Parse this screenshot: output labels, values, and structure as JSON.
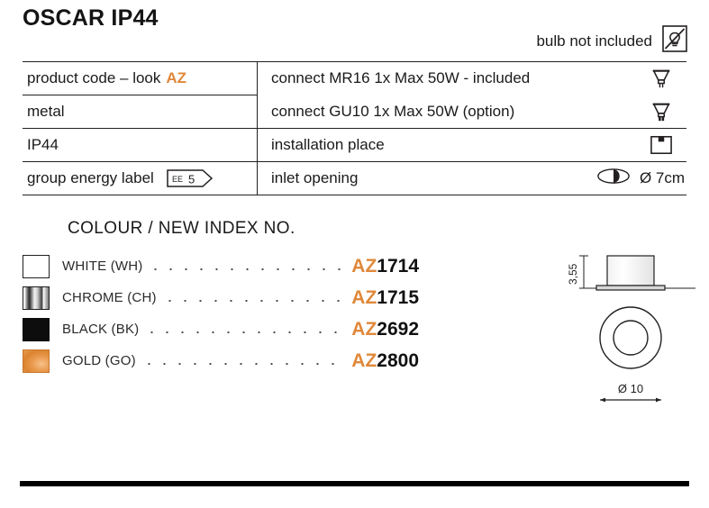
{
  "product": {
    "title": "OSCAR IP44"
  },
  "bulb_note": {
    "text": "bulb not included",
    "icon": "no-bulb-icon"
  },
  "spec_table": {
    "rows": [
      {
        "left": "product code – look",
        "left_accent": "AZ",
        "right": "connect MR16 1x Max 50W - included",
        "icon": "mr16-bulb-icon"
      },
      {
        "left": "metal",
        "right": "connect GU10 1x Max 50W (option)",
        "icon": "gu10-bulb-icon"
      },
      {
        "left": "IP44",
        "right": "installation place",
        "icon": "installation-place-icon"
      },
      {
        "left": "group energy label",
        "badge_prefix": "EE",
        "badge_value": "5",
        "right": "inlet opening",
        "icon": "inlet-opening-icon",
        "right_value": "Ø 7cm"
      }
    ]
  },
  "colour_section": {
    "heading": "COLOUR / NEW INDEX NO.",
    "items": [
      {
        "swatch": "white-swatch",
        "name": "WHITE (WH)",
        "code_prefix": "AZ",
        "code_number": "1714"
      },
      {
        "swatch": "chrome-swatch",
        "name": "CHROME (CH)",
        "code_prefix": "AZ",
        "code_number": "1715"
      },
      {
        "swatch": "black-swatch",
        "name": "BLACK (BK)",
        "code_prefix": "AZ",
        "code_number": "2692"
      },
      {
        "swatch": "gold-swatch",
        "name": "GOLD (GO)",
        "code_prefix": "AZ",
        "code_number": "2800"
      }
    ]
  },
  "technical_drawing": {
    "height_label": "3,55",
    "diameter_label": "Ø 10"
  },
  "colors": {
    "accent_orange": "#e0883a",
    "ink": "#231f20"
  }
}
